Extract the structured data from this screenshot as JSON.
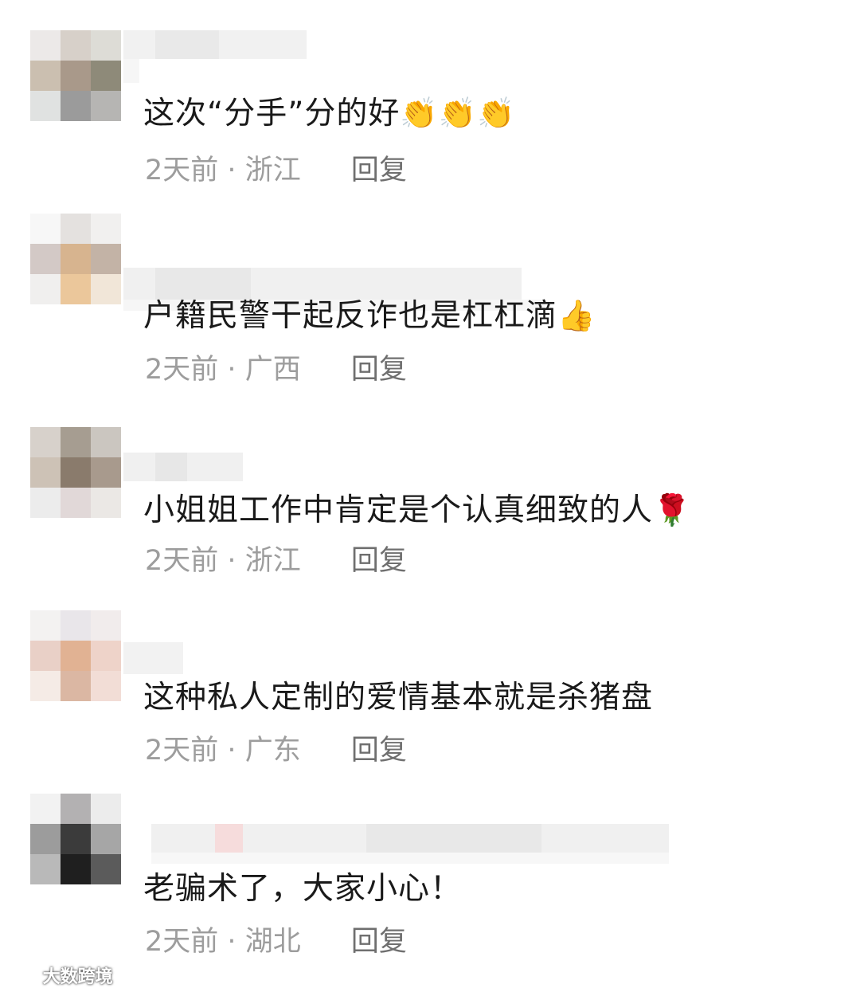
{
  "comments": [
    {
      "text": "这次“分手”分的好",
      "emoji": "👏👏👏",
      "time": "2天前",
      "separator": "·",
      "location": "浙江",
      "reply": "回复",
      "avatar_colors": [
        "#ece9e8",
        "#d7d0c9",
        "#dddcd6",
        "#cbbfb0",
        "#a9998a",
        "#8e8a79",
        "#e0e2e1",
        "#9b9b9b",
        "#b6b5b3"
      ]
    },
    {
      "text": "户籍民警干起反诈也是杠杠滴",
      "emoji": "👍",
      "time": "2天前",
      "separator": "·",
      "location": "广西",
      "reply": "回复",
      "avatar_colors": [
        "#f7f7f7",
        "#e4e1df",
        "#f1f0ef",
        "#d3c9c6",
        "#d7b48f",
        "#c3b3a6",
        "#f0efee",
        "#ebc79b",
        "#f1e6d8"
      ]
    },
    {
      "text": "小姐姐工作中肯定是个认真细致的人",
      "emoji": "🌹",
      "time": "2天前",
      "separator": "·",
      "location": "浙江",
      "reply": "回复",
      "avatar_colors": [
        "#d7d1cb",
        "#a69d91",
        "#cbc6c0",
        "#cdc2b6",
        "#8a7b6c",
        "#a89a8d",
        "#ececec",
        "#e1d8d8",
        "#ebe8e5"
      ]
    },
    {
      "text": "这种私人定制的爱情基本就是杀猪盘",
      "emoji": "",
      "time": "2天前",
      "separator": "·",
      "location": "广东",
      "reply": "回复",
      "avatar_colors": [
        "#f3f2f1",
        "#e9e6ea",
        "#f1ecec",
        "#e9d0c7",
        "#e1b293",
        "#eed3c9",
        "#f5ebe6",
        "#dbb7a3",
        "#f2ddd6"
      ]
    },
    {
      "text": "老骗术了，大家小心！",
      "emoji": "",
      "time": "2天前",
      "separator": "·",
      "location": "湖北",
      "reply": "回复",
      "avatar_colors": [
        "#f2f2f2",
        "#b3b1b2",
        "#ececec",
        "#9c9c9c",
        "#3b3b3b",
        "#a6a6a6",
        "#b9b9b9",
        "#1f1f1f",
        "#5b5b5b"
      ]
    }
  ],
  "watermark": "大数跨境"
}
